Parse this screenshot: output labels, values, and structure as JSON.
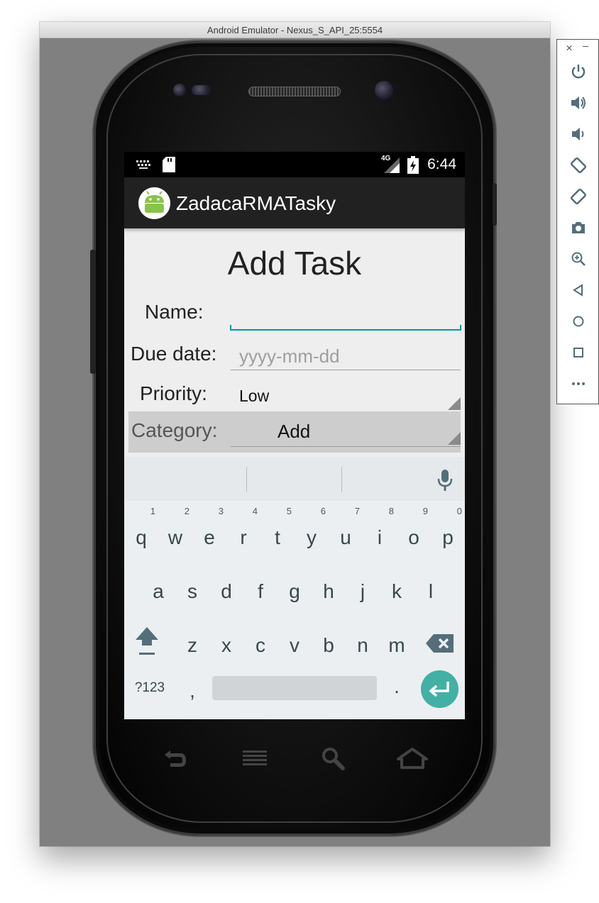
{
  "window": {
    "title": "Android Emulator - Nexus_S_API_25:5554"
  },
  "status_bar": {
    "time": "6:44",
    "network": "4G"
  },
  "action_bar": {
    "app_title": "ZadacaRMATasky"
  },
  "form": {
    "title": "Add Task",
    "name_label": "Name:",
    "name_value": "",
    "due_label": "Due date:",
    "due_placeholder": "yyyy-mm-dd",
    "priority_label": "Priority:",
    "priority_value": "Low",
    "category_label": "Category:",
    "category_value": "Add"
  },
  "keyboard": {
    "row1": [
      {
        "key": "q",
        "hint": "1"
      },
      {
        "key": "w",
        "hint": "2"
      },
      {
        "key": "e",
        "hint": "3"
      },
      {
        "key": "r",
        "hint": "4"
      },
      {
        "key": "t",
        "hint": "5"
      },
      {
        "key": "y",
        "hint": "6"
      },
      {
        "key": "u",
        "hint": "7"
      },
      {
        "key": "i",
        "hint": "8"
      },
      {
        "key": "o",
        "hint": "9"
      },
      {
        "key": "p",
        "hint": "0"
      }
    ],
    "row2": [
      "a",
      "s",
      "d",
      "f",
      "g",
      "h",
      "j",
      "k",
      "l"
    ],
    "row3": [
      "z",
      "x",
      "c",
      "v",
      "b",
      "n",
      "m"
    ],
    "symbols_label": "?123",
    "comma": ",",
    "period": "."
  },
  "colors": {
    "accent": "#0097a7",
    "enter_key": "#42b0a4",
    "action_bar": "#212121"
  }
}
